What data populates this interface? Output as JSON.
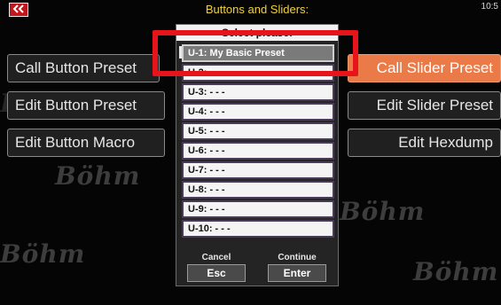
{
  "header": {
    "back_icon": "double-chevron-left-icon",
    "title": "Buttons and Sliders:",
    "clock": "10:5"
  },
  "background": {
    "logo_text": "Böhm"
  },
  "left_buttons": [
    {
      "label": "Call Button Preset"
    },
    {
      "label": "Edit Button Preset"
    },
    {
      "label": "Edit Button Macro"
    }
  ],
  "right_buttons": [
    {
      "label": "Call Slider Preset",
      "active": true
    },
    {
      "label": "Edit Slider Preset"
    },
    {
      "label": "Edit Hexdump"
    }
  ],
  "dialog": {
    "title": "Select please:",
    "items": [
      {
        "label": "U-1: My Basic Preset",
        "selected": true
      },
      {
        "label": "U-2: - - -"
      },
      {
        "label": "U-3: - - -"
      },
      {
        "label": "U-4: - - -"
      },
      {
        "label": "U-5: - - -"
      },
      {
        "label": "U-6: - - -"
      },
      {
        "label": "U-7: - - -"
      },
      {
        "label": "U-8: - - -"
      },
      {
        "label": "U-9: - - -"
      },
      {
        "label": "U-10: - - -"
      }
    ],
    "cancel": {
      "caption": "Cancel",
      "button": "Esc"
    },
    "continue": {
      "caption": "Continue",
      "button": "Enter"
    }
  },
  "colors": {
    "accent_orange": "#ea7a48",
    "title_yellow": "#f2d23a",
    "highlight_red": "#e8141b"
  }
}
